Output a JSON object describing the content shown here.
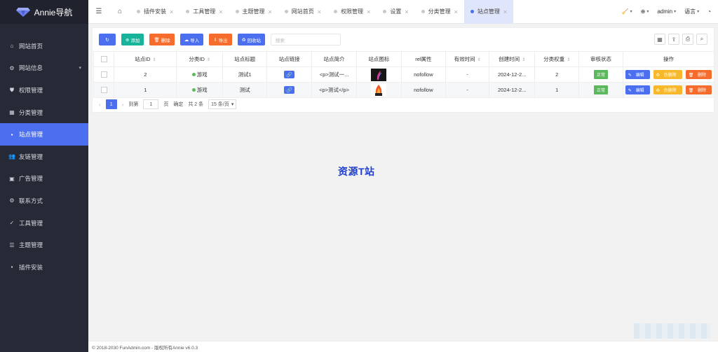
{
  "app": {
    "title": "Annie导航"
  },
  "sidebar": {
    "items": [
      {
        "label": "网站首页",
        "icon": "home-icon"
      },
      {
        "label": "网站信息",
        "icon": "gear-icon"
      },
      {
        "label": "权限管理",
        "icon": "shield-icon"
      },
      {
        "label": "分类管理",
        "icon": "category-icon"
      },
      {
        "label": "站点管理",
        "icon": "windows-icon"
      },
      {
        "label": "友链管理",
        "icon": "users-icon"
      },
      {
        "label": "广告管理",
        "icon": "image-icon"
      },
      {
        "label": "联系方式",
        "icon": "gear-icon"
      },
      {
        "label": "工具管理",
        "icon": "check-circle-icon"
      },
      {
        "label": "主题管理",
        "icon": "list-icon"
      },
      {
        "label": "插件安装",
        "icon": "windows-icon"
      }
    ]
  },
  "tabs": [
    {
      "label": "插件安装"
    },
    {
      "label": "工具管理"
    },
    {
      "label": "主题管理"
    },
    {
      "label": "网站首页"
    },
    {
      "label": "权限管理"
    },
    {
      "label": "设置"
    },
    {
      "label": "分类管理"
    },
    {
      "label": "站点管理"
    }
  ],
  "topright": {
    "user": "admin",
    "language": "语言"
  },
  "toolbar": {
    "add": "添加",
    "delete": "删除",
    "import": "导入",
    "export": "导出",
    "recycle": "回收站",
    "search_placeholder": "搜索"
  },
  "table": {
    "headers": [
      "站点ID",
      "分类ID",
      "站点标题",
      "站点链接",
      "站点简介",
      "站点图标",
      "rel属性",
      "有效时间",
      "创建时间",
      "分类权重",
      "审核状态",
      "操作"
    ],
    "rows": [
      {
        "id": "2",
        "category": "游戏",
        "title": "测试1",
        "intro": "<p>测试一...",
        "rel": "nofollow",
        "valid": "-",
        "created": "2024-12-2...",
        "weight": "2",
        "status": "正常"
      },
      {
        "id": "1",
        "category": "游戏",
        "title": "测试",
        "intro": "<p>测试</p>",
        "rel": "nofollow",
        "valid": "-",
        "created": "2024-12-2...",
        "weight": "1",
        "status": "正常"
      }
    ],
    "ops": {
      "edit": "编辑",
      "recycle": "伪删除",
      "delete": "删除"
    }
  },
  "pager": {
    "current": "1",
    "goto": "到第",
    "page_input": "1",
    "page_unit": "页",
    "confirm": "确定",
    "total": "共 2 条",
    "per_page": "15 条/页"
  },
  "watermark": "资源T站",
  "footer": "© 2018-2030 FunAdmin.com - 版权所有Annie v6.0.3",
  "colors": {
    "accent": "#4c6ff0",
    "sidebar": "#262a36",
    "success": "#5cb85c",
    "danger": "#f56c2c",
    "warning": "#f7b82b",
    "teal": "#18b39b"
  }
}
